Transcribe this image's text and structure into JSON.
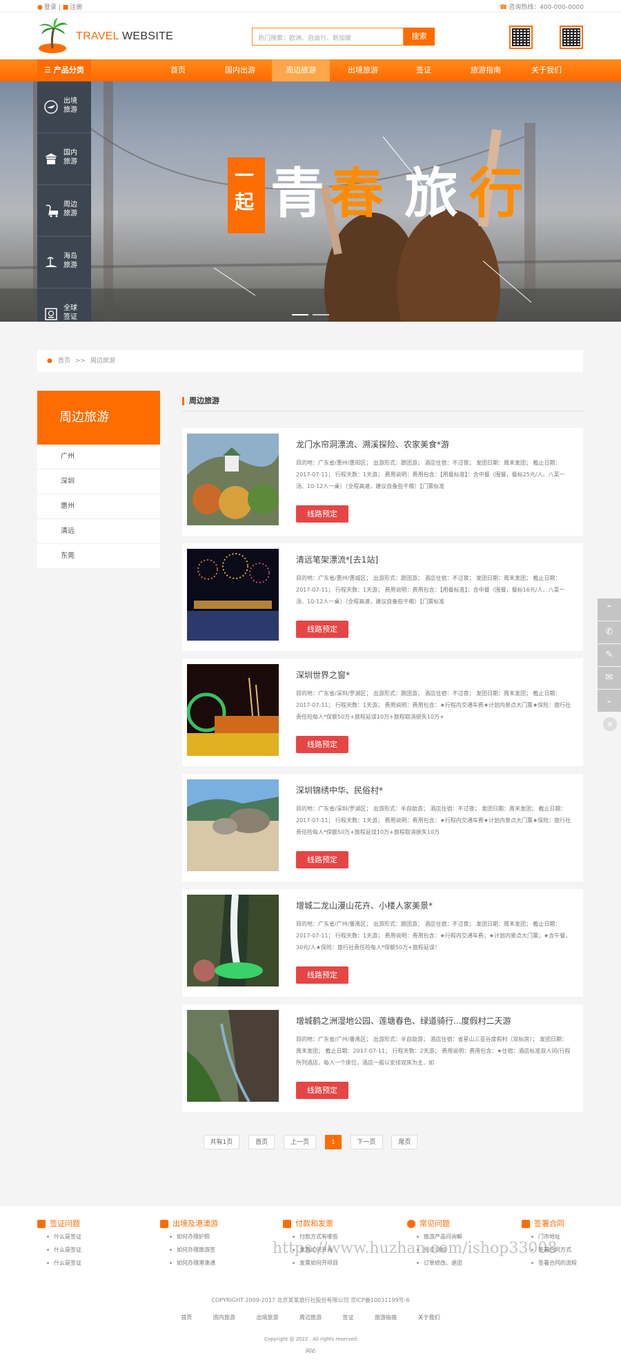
{
  "topbar": {
    "login": "登录",
    "register": "注册",
    "separator": "|",
    "hotline": "咨询热线：400-000-0000"
  },
  "logo": {
    "part1": "TRAVEL",
    "part2": "WEBSITE"
  },
  "search": {
    "placeholder": "热门搜索：欧洲、自由行、新加坡",
    "button": "搜索"
  },
  "nav": {
    "category": "产品分类",
    "items": [
      "首页",
      "国内出游",
      "周边旅游",
      "出境旅游",
      "签证",
      "旅游指南",
      "关于我们"
    ],
    "active_index": 2
  },
  "sidebar": [
    {
      "line1": "出境",
      "line2": "旅游",
      "icon": "plane-icon"
    },
    {
      "line1": "国内",
      "line2": "旅游",
      "icon": "temple-icon"
    },
    {
      "line1": "周边",
      "line2": "旅游",
      "icon": "bus-icon"
    },
    {
      "line1": "海岛",
      "line2": "旅游",
      "icon": "island-icon"
    },
    {
      "line1": "全球",
      "line2": "签证",
      "icon": "visa-icon"
    }
  ],
  "banner": {
    "text1": "一",
    "text2": "起",
    "text3": "青",
    "text4": "春",
    "text5": "旅",
    "text6": "行"
  },
  "breadcrumb": {
    "home": "首页",
    "sep": ">>",
    "current": "周边旅游"
  },
  "leftnav": {
    "title": "周边旅游",
    "items": [
      "广州",
      "深圳",
      "惠州",
      "清远",
      "东莞"
    ]
  },
  "main": {
    "title": "周边旅游",
    "button_label": "线路预定",
    "cards": [
      {
        "title": "龙门水帘洞漂流、溯溪探险、农家美食*游",
        "desc": "目的地：广东省/惠州/惠阳区； 出游形式：跟团游； 酒店住宿：不过夜； 发团日期：周末发团； 截止日期：2017-07-11； 行程天数：1天游； 费用说明：费用包含：【用餐标准】：含中餐（围餐，餐标25元/人、八菜一汤、10-12人一桌）（全程高速，建议自备些干粮）【门票标准"
      },
      {
        "title": "清远笔架漂流*[去1站]",
        "desc": "目的地：广东省/惠州/惠城区； 出游形式：跟团游； 酒店住宿：不过夜； 发团日期：周末发团； 截止日期：2017-07-11； 行程天数：1天游； 费用说明：费用包含：【用餐标准】：含中餐（围餐，餐标16元/人、八菜一汤、10-12人一桌）（全程高速，建议自备些干粮）【门票标准"
      },
      {
        "title": "深圳世界之窗*",
        "desc": "目的地：广东省/深圳/罗湖区； 出游形式：跟团游； 酒店住宿：不过夜； 发团日期：周末发团； 截止日期：2017-07-11； 行程天数：1天游； 费用说明：费用包含：★行程内交通车费★计划内景点大门票★保险：旅行社责任险每人*保额50万+旅程延误10万+旅程取消损失10万+"
      },
      {
        "title": "深圳锦绣中华、民俗村*",
        "desc": "目的地：广东省/深圳/罗湖区； 出游形式：半自助游； 酒店住宿：不过夜； 发团日期：周末发团； 截止日期：2017-07-11； 行程天数：1天游； 费用说明：费用包含：★行程内交通车费★计划内景点大门票★保险：旅行社责任险每人*保额50万+旅程延误10万+旅程取消损失10万"
      },
      {
        "title": "增城二龙山漫山花卉、小楼人家美景*",
        "desc": "目的地：广东省/广州/番禺区； 出游形式：跟团游； 酒店住宿：不过夜； 发团日期：周末发团； 截止日期：2017-07-11； 行程天数：1天游； 费用说明：费用包含：★行程内交通车费；★计划内景点大门票；★含午餐，30元/人★保险：旅行社责任险每人*保额50万+旅程延误！"
      },
      {
        "title": "增城鹤之洲湿地公园、莲塘春色、绿道骑行...度假村二天游",
        "desc": "目的地：广东省/广州/番禺区； 出游形式：半自助游； 酒店住宿：省星山三亚谷度假村（双标房）； 发团日期：周末发团； 截止日期：2017-07-11； 行程天数：2天游； 费用说明：费用包含：★住宿：酒店标准双人间(行程所列酒店，每人一个床位，酒店一般以安排双床为主，如"
      }
    ]
  },
  "pager": {
    "total": "共有1页",
    "first": "首页",
    "prev": "上一页",
    "current": "1",
    "next": "下一页",
    "last": "尾页"
  },
  "footer": {
    "cols": [
      {
        "title": "签证问题",
        "items": [
          "什么是签证",
          "什么是签证",
          "什么是签证"
        ]
      },
      {
        "title": "出境及港澳游",
        "items": [
          "如何办理护照",
          "如何办理旅游签",
          "如何办理港澳通"
        ]
      },
      {
        "title": "付款和发票",
        "items": [
          "付款方式有哪些",
          "发票如何开具",
          "发票如何开项目"
        ]
      },
      {
        "title": "常见问题",
        "items": [
          "旅游产品问询解",
          "预订须知",
          "订单修改、退团"
        ]
      },
      {
        "title": "签署合同",
        "items": [
          "门市地址",
          "签署合同方式",
          "签署合同的流程"
        ]
      }
    ],
    "copyright": "COPYRIGHT 2009-2017 北京某某旅行社股份有限公司 京ICP备10031199号-6",
    "links": [
      "首页",
      "国内旅游",
      "出境旅游",
      "周边旅游",
      "签证",
      "旅游指南",
      "关于我们"
    ],
    "copy2": "Copyright @ 2022 . All rights reserved",
    "copy3": "网站"
  },
  "watermark": "https://www.huzhan.com/ishop33008"
}
